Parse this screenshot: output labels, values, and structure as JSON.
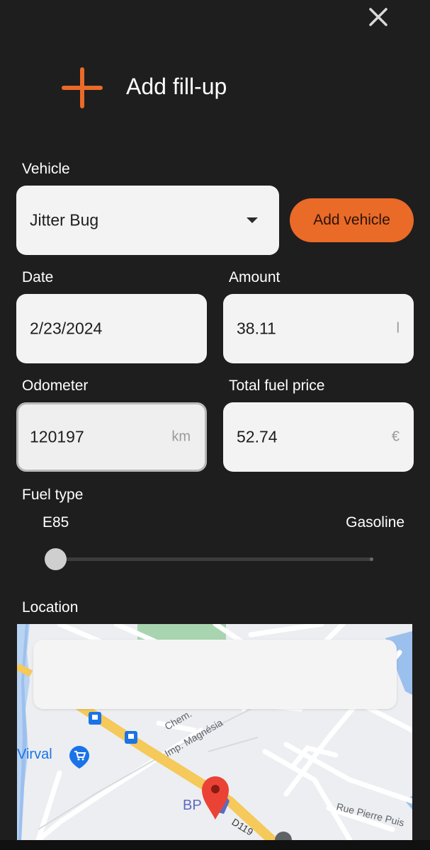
{
  "header": {
    "title": "Add fill-up",
    "icon": "plus-icon",
    "close_icon": "close-icon",
    "accent_color": "#ea6a28"
  },
  "vehicle": {
    "label": "Vehicle",
    "selected": "Jitter Bug",
    "add_button_label": "Add vehicle"
  },
  "date": {
    "label": "Date",
    "value": "2/23/2024"
  },
  "amount": {
    "label": "Amount",
    "value": "38.11",
    "unit": "l"
  },
  "odometer": {
    "label": "Odometer",
    "value": "120197",
    "unit": "km"
  },
  "price": {
    "label": "Total fuel price",
    "value": "52.74",
    "unit": "€"
  },
  "fuel_type": {
    "label": "Fuel type",
    "min_label": "E85",
    "max_label": "Gasoline",
    "slider_fraction": 0
  },
  "location": {
    "label": "Location",
    "map": {
      "labels": {
        "chem": "Chem.",
        "impasse": "Imp. Magnésia",
        "shop": "Virval",
        "station": "BP",
        "road": "D119",
        "street": "Rue Pierre Puis"
      }
    }
  }
}
